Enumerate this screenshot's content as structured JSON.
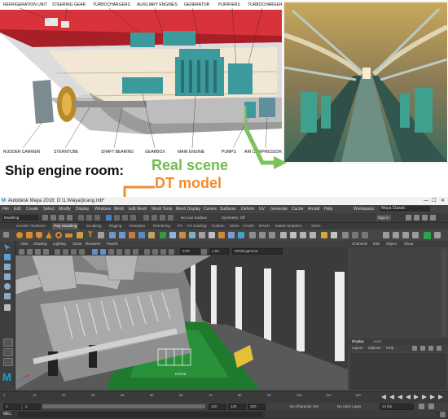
{
  "ship_labels": {
    "refrigeration_unit": "REFRIGERATION UNIT",
    "steering_gear": "STEERING GEAR",
    "turbochargers": "TURBOCHARGERS",
    "auxiliary_engines": "AUXILIARY ENGINES",
    "generator": "GENERATOR",
    "purifiers": "PURIFIERS",
    "turbocharger": "TURBOCHARGER",
    "rudder_carrier": "RUDDER CARRIER",
    "sterntube": "STERNTUBE",
    "shaft_bearing": "SHAFT BEARING",
    "gearbox": "GEARBOX",
    "main_engine": "MAIN ENGINE",
    "pumps": "PUMPS",
    "air_compressor": "AIR COMPRESSOR"
  },
  "titles": {
    "main": "Ship engine room:",
    "real": "Real scene",
    "dt": "DT model"
  },
  "maya": {
    "window_title": "Autodesk Maya 2018: D:\\1.\\Maya\\jicang.mb*",
    "menus": [
      "File",
      "Edit",
      "Create",
      "Select",
      "Modify",
      "Display",
      "Windows",
      "Mesh",
      "Edit Mesh",
      "Mesh Tools",
      "Mesh Display",
      "Curves",
      "Surfaces",
      "Deform",
      "UV",
      "Generate",
      "Cache",
      "Arnold",
      "Help"
    ],
    "workspace_label": "Workspace:",
    "workspace_value": "Maya Classic",
    "mode": "Modeling",
    "no_live_surface": "No Live Surface",
    "symmetry": "Symmetry: Off",
    "sign_in": "Sign in",
    "shelf_tabs": [
      "Curves / Surfaces",
      "Poly Modeling",
      "Sculpting",
      "Rigging",
      "Animation",
      "Rendering",
      "FX",
      "FX Caching",
      "Custom",
      "XGen",
      "Arnold",
      "MASH",
      "Motion Graphics",
      "XGen"
    ],
    "viewport_menus": [
      "View",
      "Shading",
      "Lighting",
      "Show",
      "Renderer",
      "Panels"
    ],
    "viewport_val1": "0.00",
    "viewport_val2": "1.00",
    "color_space": "sRGB gamma",
    "channel_tabs": [
      "Channels",
      "Edit",
      "Object",
      "Show"
    ],
    "layer_tabs": [
      "Display",
      "Anim"
    ],
    "layer_menus": [
      "Layers",
      "Options",
      "Help"
    ],
    "timeline_ticks": [
      "1",
      "10",
      "20",
      "30",
      "40",
      "50",
      "60",
      "70",
      "80",
      "90",
      "100",
      "110",
      "120"
    ],
    "range_start": "1",
    "range_field": "1",
    "range_mid": "120",
    "range_end": "120",
    "range_max": "200",
    "no_character_set": "No Character Set",
    "no_anim_layer": "No Anim Layer",
    "fps": "24 fps",
    "mel": "MEL",
    "screen_label": "DHTKD"
  }
}
